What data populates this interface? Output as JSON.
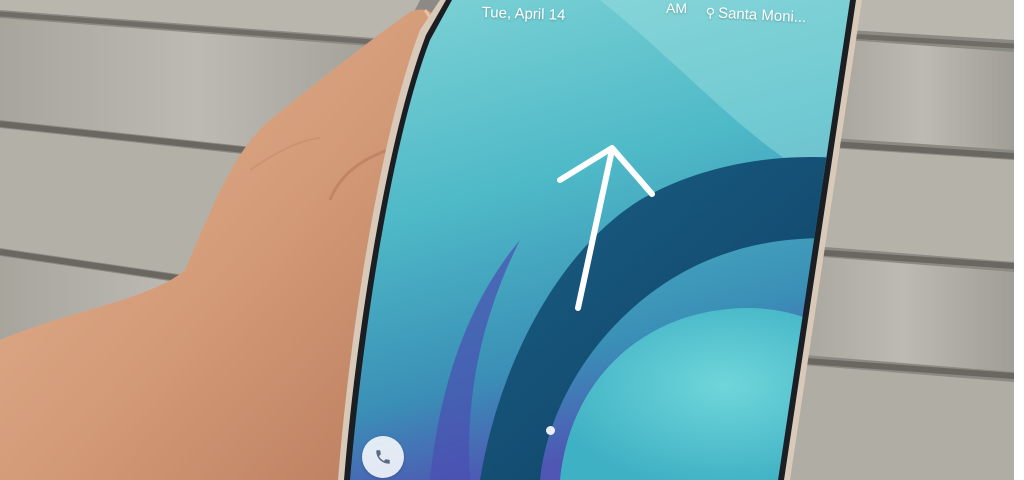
{
  "lock_screen": {
    "date": "Tue, April 14",
    "ampm": "AM",
    "location": "Santa Moni...",
    "location_icon": "location-pin-icon",
    "call_icon": "phone-icon",
    "swipe_icon": "swipe-up-arrow-icon"
  },
  "colors": {
    "deck": "#8c8a84",
    "skin": "#d9a27f",
    "screen_teal": "#5fc7cf",
    "screen_deep": "#1d6f8e",
    "screen_violet": "#5b5bb8"
  }
}
